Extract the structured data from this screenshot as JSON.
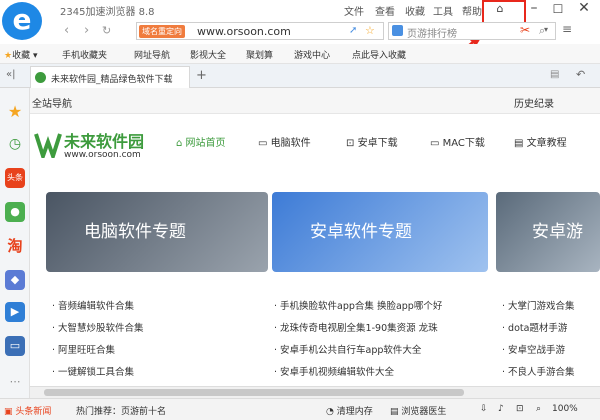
{
  "titlebar": {
    "app_title": "2345加速浏览器 8.8",
    "menus": [
      "文件",
      "查看",
      "收藏",
      "工具",
      "帮助"
    ]
  },
  "address": {
    "redirect_label": "域名重定向",
    "url": "www.orsoon.com",
    "search_placeholder": "页游排行榜"
  },
  "bookmarks": {
    "items": [
      "收藏",
      "手机收藏夹",
      "网址导航",
      "影视大全",
      "聚划算",
      "游戏中心",
      "点此导入收藏"
    ]
  },
  "tab": {
    "title": "未来软件园_精品绿色软件下载"
  },
  "page": {
    "top_left": "全站导航",
    "top_right": "历史纪录",
    "site_name": "未来软件园",
    "site_url": "www.orsoon.com",
    "nav": [
      "网站首页",
      "电脑软件",
      "安卓下载",
      "MAC下载",
      "文章教程"
    ],
    "banners": [
      "电脑软件专题",
      "安卓软件专题",
      "安卓游"
    ],
    "list1": [
      "音频编辑软件合集",
      "大智慧炒股软件合集",
      "阿里旺旺合集",
      "一键解锁工具合集"
    ],
    "list2": [
      "手机换脸软件app合集 换脸app哪个好",
      "龙珠传奇电视剧全集1-90集资源 龙珠",
      "安卓手机公共自行车app软件大全",
      "安卓手机视频编辑软件大全"
    ],
    "list3": [
      "大掌门游戏合集",
      "dota题材手游",
      "安卓空战手游",
      "不良人手游合集"
    ]
  },
  "statusbar": {
    "news": "头条新闻",
    "hot": "热门推荐：页游前十名",
    "clean": "清理内存",
    "doctor": "浏览器医生",
    "zoom": "100%"
  },
  "colors": {
    "accent": "#e8421c",
    "blue": "#1e88e5",
    "green": "#3d9b3d"
  }
}
